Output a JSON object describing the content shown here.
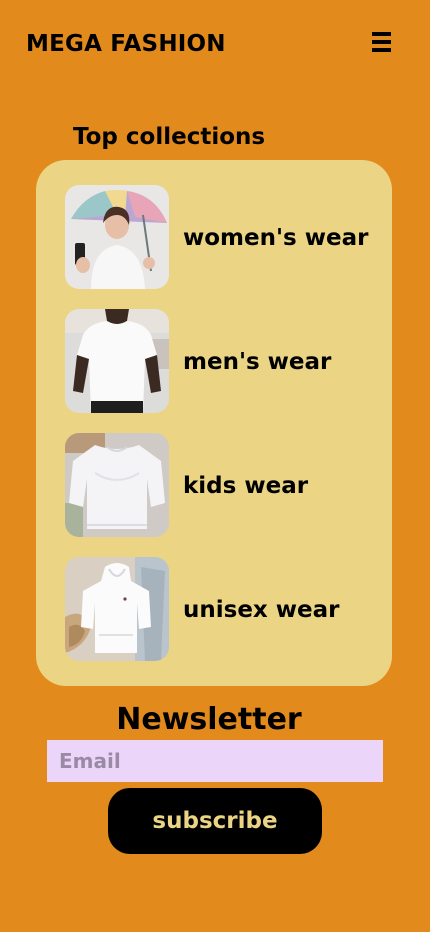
{
  "header": {
    "brand": "MEGA FASHION",
    "menu_icon": "hamburger-menu-icon"
  },
  "collections": {
    "title": "Top collections",
    "items": [
      {
        "label": "women's wear",
        "image": "woman-with-umbrella-photo"
      },
      {
        "label": "men's wear",
        "image": "man-white-tshirt-photo"
      },
      {
        "label": "kids wear",
        "image": "white-sweatshirt-photo"
      },
      {
        "label": "unisex wear",
        "image": "white-hoodie-photo"
      }
    ]
  },
  "newsletter": {
    "title": "Newsletter",
    "email_placeholder": "Email",
    "email_value": "",
    "subscribe_label": "subscribe"
  },
  "colors": {
    "background": "#e28b1c",
    "card": "#ebd484",
    "input": "#ebd5f8",
    "button": "#000000",
    "button_text": "#ebd484"
  }
}
